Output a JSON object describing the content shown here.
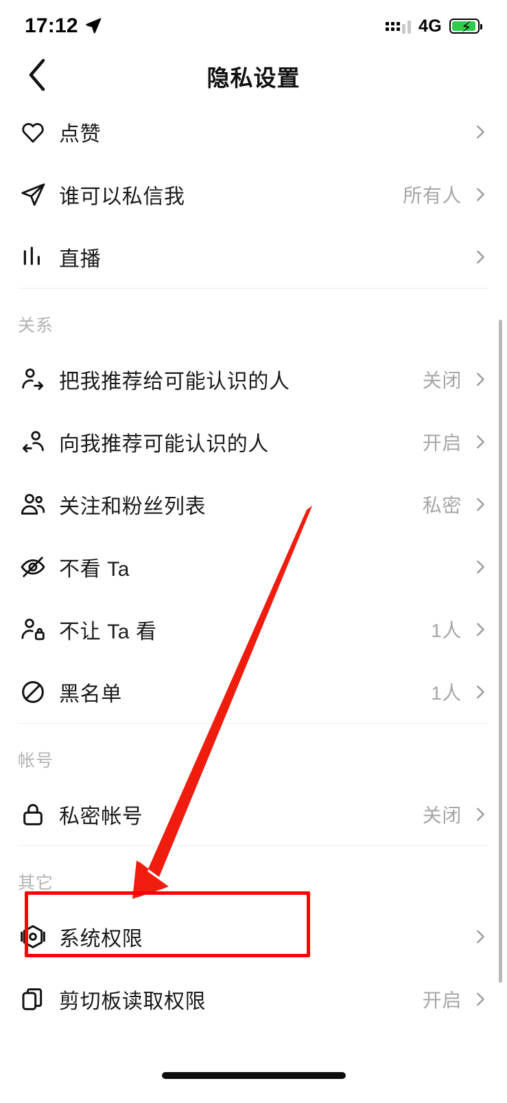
{
  "status_bar": {
    "time": "17:12",
    "location_icon": "location-arrow-icon",
    "signal_icon": "signal-dots-icon",
    "network": "4G",
    "battery_icon": "battery-charging-icon",
    "battery_color": "#2fcc4c"
  },
  "nav": {
    "back_icon": "chevron-left-icon",
    "title": "隐私设置"
  },
  "list": [
    {
      "kind": "row",
      "icon": "heart-icon",
      "label": "点赞",
      "value": ""
    },
    {
      "kind": "row",
      "icon": "send-icon",
      "label": "谁可以私信我",
      "value": "所有人"
    },
    {
      "kind": "row",
      "icon": "live-bars-icon",
      "label": "直播",
      "value": ""
    },
    {
      "kind": "divider"
    },
    {
      "kind": "section",
      "title": "关系"
    },
    {
      "kind": "row",
      "icon": "person-share-icon",
      "label": "把我推荐给可能认识的人",
      "value": "关闭"
    },
    {
      "kind": "row",
      "icon": "person-receive-icon",
      "label": "向我推荐可能认识的人",
      "value": "开启"
    },
    {
      "kind": "row",
      "icon": "people-icon",
      "label": "关注和粉丝列表",
      "value": "私密"
    },
    {
      "kind": "row",
      "icon": "eye-off-icon",
      "label": "不看 Ta",
      "value": ""
    },
    {
      "kind": "row",
      "icon": "person-lock-icon",
      "label": "不让 Ta 看",
      "value": "1人"
    },
    {
      "kind": "row",
      "icon": "block-icon",
      "label": "黑名单",
      "value": "1人"
    },
    {
      "kind": "divider"
    },
    {
      "kind": "section",
      "title": "帐号"
    },
    {
      "kind": "row",
      "icon": "lock-icon",
      "label": "私密帐号",
      "value": "关闭"
    },
    {
      "kind": "divider"
    },
    {
      "kind": "section",
      "title": "其它"
    },
    {
      "kind": "row",
      "icon": "hexagon-permission-icon",
      "label": "系统权限",
      "value": "",
      "highlighted": true
    },
    {
      "kind": "row",
      "icon": "clipboard-icon",
      "label": "剪切板读取权限",
      "value": "开启"
    }
  ],
  "annotation": {
    "highlight_color": "#ff0000",
    "arrow_icon": "red-arrow-annotation",
    "box_icon": "red-rectangle-annotation",
    "target_label": "系统权限"
  }
}
